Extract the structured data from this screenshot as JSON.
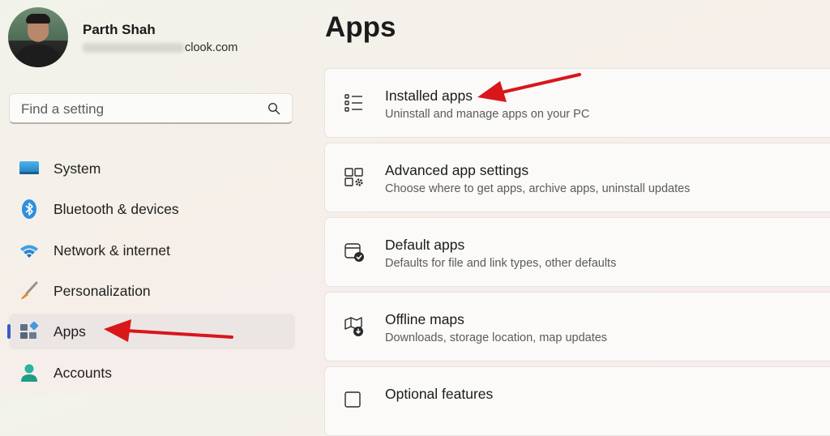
{
  "user": {
    "name": "Parth Shah",
    "email_visible": "clook.com"
  },
  "search": {
    "placeholder": "Find a setting"
  },
  "sidebar": {
    "items": [
      {
        "label": "System",
        "icon": "monitor-icon"
      },
      {
        "label": "Bluetooth & devices",
        "icon": "bluetooth-icon"
      },
      {
        "label": "Network & internet",
        "icon": "wifi-icon"
      },
      {
        "label": "Personalization",
        "icon": "brush-icon"
      },
      {
        "label": "Apps",
        "icon": "apps-icon",
        "selected": true
      },
      {
        "label": "Accounts",
        "icon": "person-icon"
      }
    ]
  },
  "main": {
    "title": "Apps",
    "cards": [
      {
        "title": "Installed apps",
        "subtitle": "Uninstall and manage apps on your PC",
        "icon": "list-icon"
      },
      {
        "title": "Advanced app settings",
        "subtitle": "Choose where to get apps, archive apps, uninstall updates",
        "icon": "apps-gear-icon"
      },
      {
        "title": "Default apps",
        "subtitle": "Defaults for file and link types, other defaults",
        "icon": "window-check-icon"
      },
      {
        "title": "Offline maps",
        "subtitle": "Downloads, storage location, map updates",
        "icon": "map-download-icon"
      },
      {
        "title": "Optional features",
        "subtitle": "",
        "icon": "optional-features-icon"
      }
    ]
  },
  "colors": {
    "accent": "#3b5cc4",
    "annotation_arrow": "#d9161a",
    "selected_background": "#ebe6e3"
  }
}
